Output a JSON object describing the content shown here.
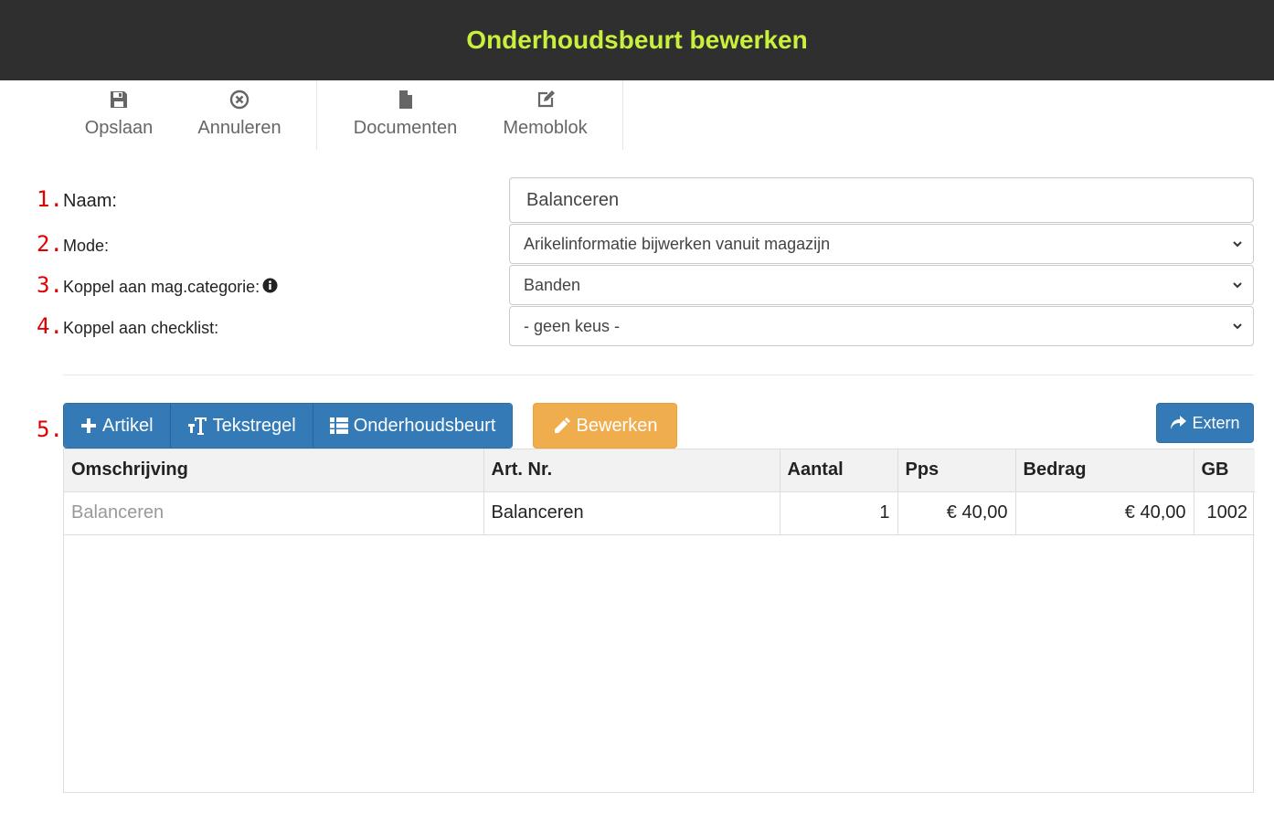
{
  "header": {
    "title": "Onderhoudsbeurt bewerken"
  },
  "toolbar": {
    "save": {
      "label": "Opslaan",
      "icon": "save-icon"
    },
    "cancel": {
      "label": "Annuleren",
      "icon": "times-circle-icon"
    },
    "documents": {
      "label": "Documenten",
      "icon": "file-icon"
    },
    "memo": {
      "label": "Memoblok",
      "icon": "edit-icon"
    }
  },
  "form": {
    "numbers": [
      "1.",
      "2.",
      "3.",
      "4.",
      "5."
    ],
    "name": {
      "label": "Naam:",
      "value": "Balanceren"
    },
    "mode": {
      "label": "Mode:",
      "value": "Arikelinformatie bijwerken vanuit magazijn"
    },
    "category": {
      "label": "Koppel aan mag.categorie:",
      "value": "Banden",
      "info_icon": "info-circle-icon"
    },
    "checklist": {
      "label": "Koppel aan checklist:",
      "value": "- geen keus -"
    }
  },
  "actions": {
    "article": "Artikel",
    "textline": "Tekstregel",
    "service": "Onderhoudsbeurt",
    "edit": "Bewerken",
    "extern": "Extern"
  },
  "table": {
    "columns": [
      "Omschrijving",
      "Art. Nr.",
      "Aantal",
      "Pps",
      "Bedrag",
      "GB"
    ],
    "rows": [
      [
        "Balanceren",
        "Balanceren",
        "1",
        "€ 40,00",
        "€ 40,00",
        "1002"
      ]
    ]
  },
  "colors": {
    "title": "#c8f03c",
    "header_bg": "#2f2f2f",
    "primary": "#337ab7",
    "warning": "#f0ad4e",
    "number": "#e00000"
  }
}
